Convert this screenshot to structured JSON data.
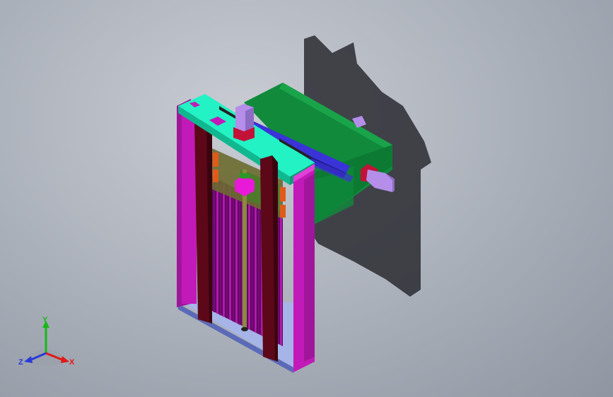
{
  "viewport": {
    "background_top": "#c9ccd3",
    "background_bottom": "#8f96a1"
  },
  "model": {
    "colors": {
      "frame_magenta": "#c21ab8",
      "frame_dark": "#5c0818",
      "top_plate_cyan": "#22f2c4",
      "carriage_green": "#118a3c",
      "motor_violet": "#b48ee8",
      "rail_blue": "#3a33d8",
      "coupler_orange": "#e05a1a",
      "shadow": "#2a2c31"
    }
  },
  "triad": {
    "y_label": "Y",
    "x_label": "X",
    "z_label": "Z",
    "colors": {
      "y": "#18b818",
      "x": "#e01818",
      "z": "#2a3ad8"
    }
  }
}
